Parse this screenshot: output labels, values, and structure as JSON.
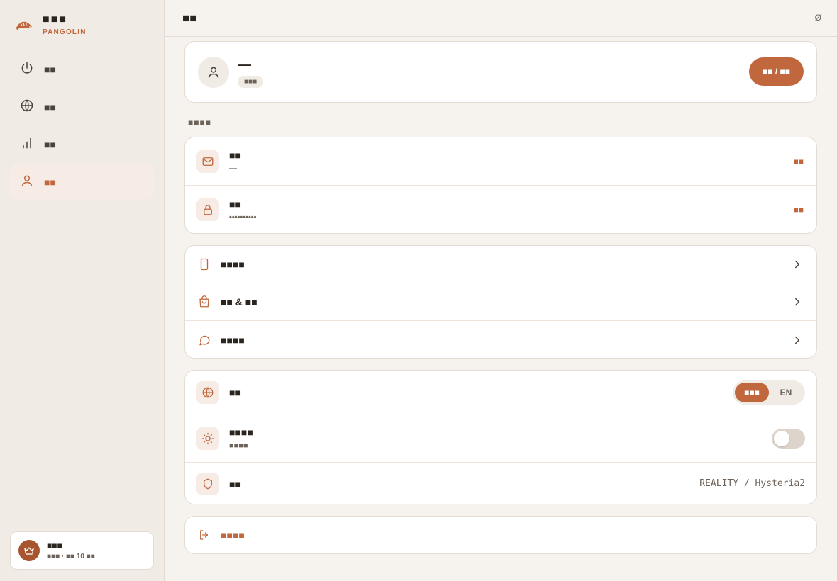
{
  "sidebar": {
    "brand_name": "■■■",
    "brand_sub": "PANGOLIN",
    "nav": [
      {
        "label": "■■",
        "icon": "power-icon"
      },
      {
        "label": "■■",
        "icon": "globe-icon"
      },
      {
        "label": "■■",
        "icon": "stats-icon"
      },
      {
        "label": "■■",
        "icon": "user-icon",
        "active": true
      }
    ],
    "plan": {
      "title": "■■■",
      "subtitle": "■■■ · ■■ 10 ■■",
      "icon": "crown-icon"
    }
  },
  "header": {
    "title": "■■",
    "right_text": "Ø"
  },
  "profile": {
    "name": "—",
    "tier": "■■■",
    "button": "■■ / ■■"
  },
  "account": {
    "section_label": "■■■■",
    "rows": [
      {
        "icon": "mail-icon",
        "title": "■■",
        "subtitle": "—",
        "action": "■■"
      },
      {
        "icon": "lock-icon",
        "title": "■■",
        "subtitle": "••••••••••",
        "action": "■■"
      }
    ]
  },
  "menus": [
    {
      "icon": "phone-icon",
      "label": "■■■■"
    },
    {
      "icon": "bag-icon",
      "label": "■■ & ■■"
    },
    {
      "icon": "chat-icon",
      "label": "■■■■"
    }
  ],
  "prefs": {
    "language": {
      "icon": "globe-icon",
      "label": "■■",
      "options": [
        "■■■",
        "EN"
      ],
      "selected": 0
    },
    "theme": {
      "icon": "sun-icon",
      "label": "■■■■",
      "subtitle": "■■■■",
      "enabled": false
    },
    "protocol": {
      "icon": "shield-icon",
      "label": "■■",
      "value": "REALITY / Hysteria2"
    }
  },
  "logout": {
    "icon": "logout-icon",
    "label": "■■■■"
  },
  "colors": {
    "accent": "#c0673d",
    "background": "#f6f3ef",
    "sidebar": "#f1ebe5"
  }
}
